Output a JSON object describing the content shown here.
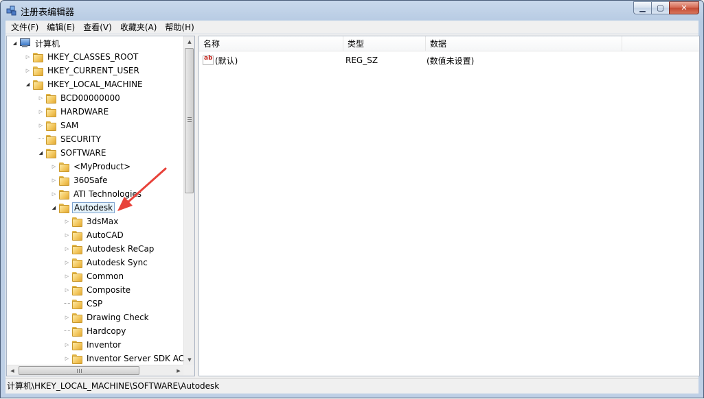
{
  "window": {
    "title": "注册表编辑器",
    "caption_buttons": {
      "minimize": "▁",
      "maximize": "▢",
      "close": "✕"
    }
  },
  "menu": [
    "文件(F)",
    "编辑(E)",
    "查看(V)",
    "收藏夹(A)",
    "帮助(H)"
  ],
  "tree": {
    "root": "计算机",
    "nodes": [
      {
        "label": "HKEY_CLASSES_ROOT",
        "expander": "closed"
      },
      {
        "label": "HKEY_CURRENT_USER",
        "expander": "closed"
      },
      {
        "label": "HKEY_LOCAL_MACHINE",
        "expander": "open"
      },
      {
        "label": "BCD00000000",
        "expander": "closed"
      },
      {
        "label": "HARDWARE",
        "expander": "closed"
      },
      {
        "label": "SAM",
        "expander": "closed"
      },
      {
        "label": "SECURITY",
        "expander": "none"
      },
      {
        "label": "SOFTWARE",
        "expander": "open"
      },
      {
        "label": "<MyProduct>",
        "expander": "closed"
      },
      {
        "label": "360Safe",
        "expander": "closed"
      },
      {
        "label": "ATI Technologies",
        "expander": "closed"
      },
      {
        "label": "Autodesk",
        "expander": "open",
        "selected": true
      },
      {
        "label": "3dsMax",
        "expander": "closed"
      },
      {
        "label": "AutoCAD",
        "expander": "closed"
      },
      {
        "label": "Autodesk ReCap",
        "expander": "closed"
      },
      {
        "label": "Autodesk Sync",
        "expander": "closed"
      },
      {
        "label": "Common",
        "expander": "closed"
      },
      {
        "label": "Composite",
        "expander": "closed"
      },
      {
        "label": "CSP",
        "expander": "none"
      },
      {
        "label": "Drawing Check",
        "expander": "closed"
      },
      {
        "label": "Hardcopy",
        "expander": "none"
      },
      {
        "label": "Inventor",
        "expander": "closed"
      },
      {
        "label": "Inventor Server SDK AC",
        "expander": "closed"
      }
    ]
  },
  "list": {
    "columns": [
      "名称",
      "类型",
      "数据"
    ],
    "rows": [
      {
        "name": "(默认)",
        "type": "REG_SZ",
        "data": "(数值未设置)",
        "icon": "string-value-icon",
        "icon_text": "ab"
      }
    ]
  },
  "status_path": "计算机\\HKEY_LOCAL_MACHINE\\SOFTWARE\\Autodesk",
  "colors": {
    "annotation_arrow": "#e8423a",
    "selection_border": "#7da2ce"
  }
}
